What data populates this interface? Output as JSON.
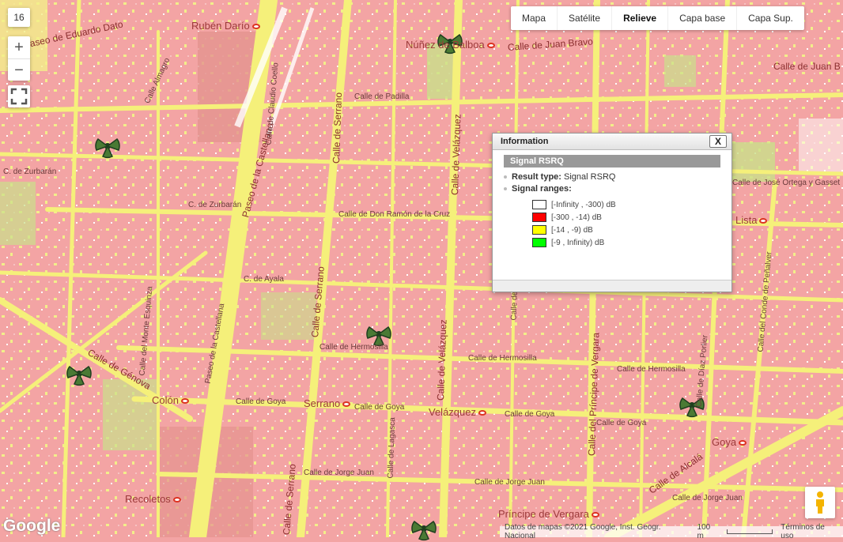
{
  "zoom_level": "16",
  "zoom_in_label": "+",
  "zoom_out_label": "−",
  "map_types": [
    {
      "label": "Mapa",
      "active": false
    },
    {
      "label": "Satélite",
      "active": false
    },
    {
      "label": "Relieve",
      "active": true
    },
    {
      "label": "Capa base",
      "active": false
    },
    {
      "label": "Capa Sup.",
      "active": false
    }
  ],
  "info_window": {
    "title": "Information",
    "close_label": "X",
    "header": "Signal RSRQ",
    "result_type_label": "Result type:",
    "result_type_value": "Signal RSRQ",
    "signal_ranges_label": "Signal ranges:",
    "ranges": [
      {
        "label": "[-Infinity , -300) dB",
        "color": "#ffffff"
      },
      {
        "label": "[-300 , -14) dB",
        "color": "#ff0000"
      },
      {
        "label": "[-14 , -9) dB",
        "color": "#ffff00"
      },
      {
        "label": "[-9 , Infinity) dB",
        "color": "#00ff00"
      }
    ]
  },
  "colors": {
    "coverage_red": "#f3a4a4",
    "coverage_yellow": "#f2ef8a",
    "coverage_green": "#c9e08a",
    "street_yellow": "#f5f07a"
  },
  "streets": {
    "ruben_dario": "Rubén Darío",
    "paseo_eduardo_dato": "Paseo de Eduardo Dato",
    "nunez_balboa": "Núñez de Balboa",
    "calle_juan_bravo_1": "Calle de Juan Bravo",
    "calle_juan_bravo_2": "Calle de Juan B",
    "calle_zurbaran_1": "C. de Zurbarán",
    "calle_zurbaran_2": "C. de Zurbarán",
    "don_ramon_cruz": "Calle de Don Ramón de la Cruz",
    "jose_ortega": "Calle de José Ortega y Gasset",
    "lista": "Lista",
    "paseo_castellana_1": "Paseo de la Castellana",
    "paseo_castellana_2": "Paseo de la Castellana",
    "calle_serrano_1": "Calle de Serrano",
    "calle_serrano_2": "Calle de Serrano",
    "calle_serrano_3": "Calle de Serrano",
    "calle_velazquez_1": "Calle de Velázquez",
    "calle_velazquez_2": "Calle de Velázquez",
    "calle_ayala": "C. de Ayala",
    "calle_hermosilla_1": "Calle de Hermosilla",
    "calle_hermosilla_2": "Calle de Hermosilla",
    "calle_hermosilla_3": "Calle de Hermosilla",
    "calle_genova": "Calle de Génova",
    "colon": "Colón",
    "serrano_metro": "Serrano",
    "velazquez_metro": "Velázquez",
    "calle_goya_1": "Calle de Goya",
    "calle_goya_2": "Calle de Goya",
    "calle_goya_3": "Calle de Goya",
    "calle_goya_4": "Calle de Goya",
    "goya": "Goya",
    "calle_jorge_juan_1": "Calle de Jorge Juan",
    "calle_jorge_juan_2": "Calle de Jorge Juan",
    "calle_jorge_juan_3": "Calle de Jorge Juan",
    "recoletos": "Recoletos",
    "principe_vergara_1": "Príncipe de Vergara",
    "principe_vergara_2": "Calle del Príncipe de Vergara",
    "calle_alcala": "Calle de Alcalá",
    "conde_penalver": "Calle del Conde de Peñalver",
    "diaz_porlier": "Calle de Díaz Porlier",
    "calle_almagro": "Calle Almagro",
    "monte_esquinza": "Calle del Monte Esquinza",
    "calle_lagasca": "Calle de Lagasca",
    "calle_claudio_coello": "Calle de Claudio Coello",
    "calle_castello": "Calle de Castelló",
    "calle_padilla": "Calle de Padilla"
  },
  "attribution": {
    "map_data": "Datos de mapas ©2021 Google, Inst. Geogr. Nacional",
    "scale": "100 m",
    "terms": "Términos de uso"
  },
  "logo": "Google"
}
